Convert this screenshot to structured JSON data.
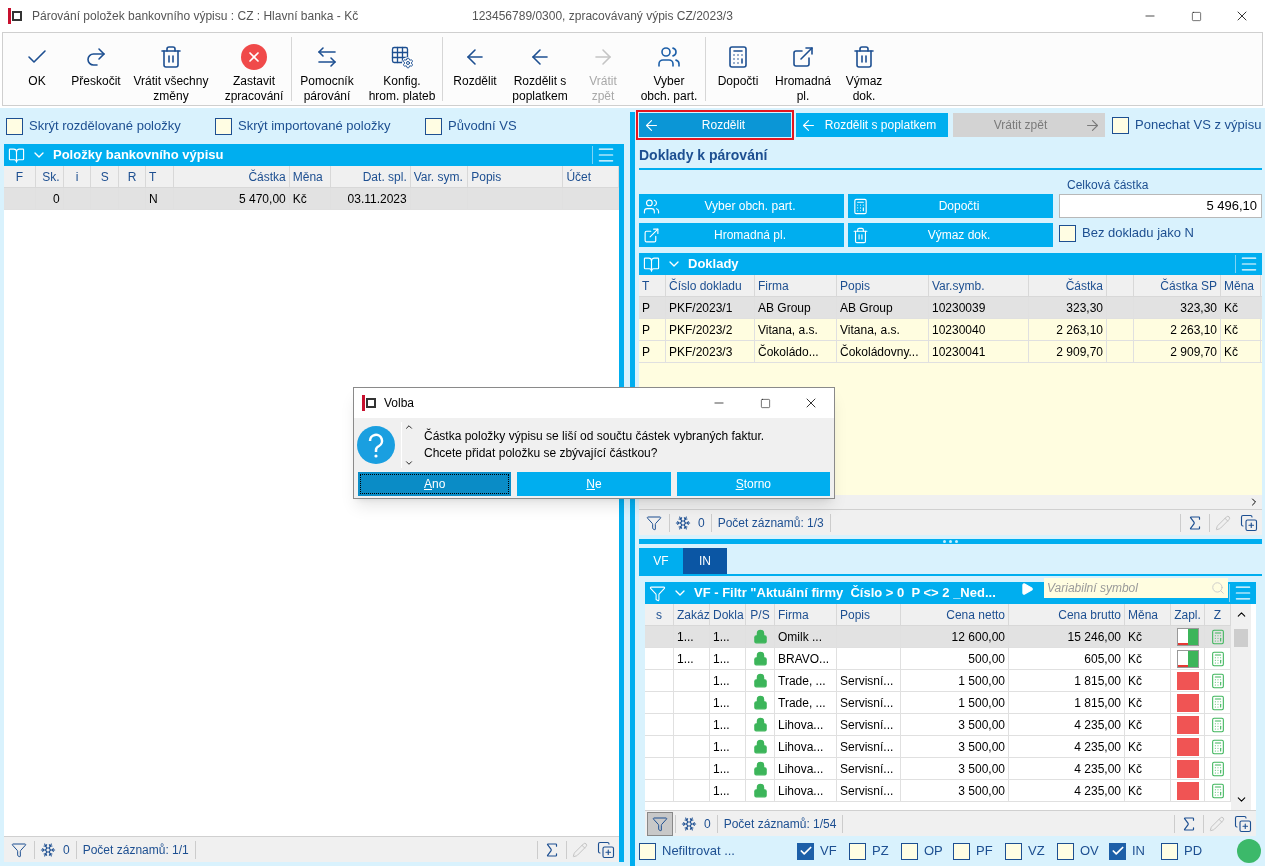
{
  "window": {
    "title": "Párování položek bankovního výpisu : CZ : Hlavní banka - Kč",
    "subtitle": "123456789/0300, zpracovávaný výpis CZ/2023/3"
  },
  "toolbar": [
    [
      {
        "label": "OK",
        "disabled": false
      },
      {
        "label": "Přeskočit",
        "disabled": false
      },
      {
        "label": "Vrátit všechny\nzměny",
        "disabled": false
      },
      {
        "label": "Zastavit\nzpracování",
        "disabled": false
      }
    ],
    [
      {
        "label": "Pomocník\npárování",
        "disabled": false
      },
      {
        "label": "Konfig.\nhrom. plateb",
        "disabled": false
      }
    ],
    [
      {
        "label": "Rozdělit",
        "disabled": false
      },
      {
        "label": "Rozdělit s\npoplatkem",
        "disabled": false
      },
      {
        "label": "Vrátit\nzpět",
        "disabled": true
      },
      {
        "label": "Vyber\nobch. part.",
        "disabled": false
      }
    ],
    [
      {
        "label": "Dopočti",
        "disabled": false
      },
      {
        "label": "Hromadná\npl.",
        "disabled": false
      },
      {
        "label": "Výmaz\ndok.",
        "disabled": false
      }
    ]
  ],
  "left_panel": {
    "options": [
      {
        "label": "Skrýt rozdělované položky",
        "checked": false
      },
      {
        "label": "Skrýt importované položky",
        "checked": false
      },
      {
        "label": "Původní VS",
        "checked": false
      }
    ],
    "grid": {
      "title": "Položky bankovního výpisu",
      "columns": [
        "F",
        "Sk.",
        "i",
        "S",
        "R",
        "T",
        "Částka",
        "Měna",
        "Dat. spl.",
        "Var. sym.",
        "Popis",
        "Účet"
      ],
      "rows": [
        {
          "selected": true,
          "cells": [
            null,
            "0",
            null,
            null,
            null,
            "N",
            "5 470,00",
            "Kč",
            "03.11.2023",
            null,
            null,
            null
          ]
        }
      ]
    },
    "footer": {
      "count": "0",
      "records": "Počet záznamů: 1/1"
    }
  },
  "right_panel": {
    "actions": [
      {
        "label": "Rozdělit",
        "highlighted": true,
        "disabled": false
      },
      {
        "label": "Rozdělit s poplatkem",
        "highlighted": false,
        "disabled": false
      },
      {
        "label": "Vrátit zpět",
        "highlighted": false,
        "disabled": true
      }
    ],
    "keep_vs": {
      "label": "Ponechat VS z výpisu",
      "checked": false
    },
    "section_title": "Doklady k párování",
    "doc_buttons": [
      "Vyber obch. part.",
      "Dopočti",
      "Hromadná pl.",
      "Výmaz dok."
    ],
    "total": {
      "label": "Celková částka",
      "value": "5 496,10"
    },
    "no_doc": {
      "label": "Bez dokladu jako N",
      "checked": false
    },
    "docs_grid": {
      "title": "Doklady",
      "columns": [
        "T",
        "Číslo dokladu",
        "Firma",
        "Popis",
        "Var.symb.",
        "Částka",
        null,
        "Částka SP",
        "Měna"
      ],
      "rows": [
        {
          "selected": true,
          "cells": [
            "P",
            "PKF/2023/1",
            "AB Group",
            "AB Group",
            "10230039",
            "323,30",
            null,
            "323,30",
            "Kč"
          ]
        },
        {
          "selected": false,
          "cells": [
            "P",
            "PKF/2023/2",
            "Vitana, a.s.",
            "Vitana, a.s.",
            "10230040",
            "2 263,10",
            null,
            "2 263,10",
            "Kč"
          ]
        },
        {
          "selected": false,
          "cells": [
            "P",
            "PKF/2023/3",
            "Čokoládo...",
            "Čokoládovny...",
            "10230041",
            "2 909,70",
            null,
            "2 909,70",
            "Kč"
          ]
        }
      ],
      "footer": {
        "count": "0",
        "records": "Počet záznamů: 1/3"
      }
    },
    "tabs": [
      {
        "label": "VF",
        "selected": false
      },
      {
        "label": "IN",
        "selected": true
      }
    ],
    "invoices": {
      "filter_title": "VF - Filtr \"Aktuální firmy  Číslo > 0  P <> 2 _Ned...",
      "search_placeholder": "Variabilní symbol",
      "columns": [
        "s",
        "Zakáz",
        "Dokla",
        "P/S",
        "Firma",
        "Popis",
        "Cena netto",
        "Cena brutto",
        "Měna",
        "Zapl.",
        "Z"
      ],
      "rows": [
        {
          "selected": true,
          "kind": "partial",
          "cells": [
            null,
            "1...",
            "1...",
            null,
            "Omilk ...",
            null,
            "12 600,00",
            "15 246,00",
            "Kč",
            null,
            null
          ]
        },
        {
          "selected": false,
          "kind": "partial",
          "cells": [
            null,
            "1...",
            "1...",
            null,
            "BRAVO...",
            null,
            "500,00",
            "605,00",
            "Kč",
            null,
            null
          ]
        },
        {
          "selected": false,
          "kind": "unpaid",
          "cells": [
            null,
            null,
            "1...",
            null,
            "Trade, ...",
            "Servisní...",
            "1 500,00",
            "1 815,00",
            "Kč",
            null,
            null
          ]
        },
        {
          "selected": false,
          "kind": "unpaid",
          "cells": [
            null,
            null,
            "1...",
            null,
            "Trade, ...",
            "Servisní...",
            "1 500,00",
            "1 815,00",
            "Kč",
            null,
            null
          ]
        },
        {
          "selected": false,
          "kind": "unpaid",
          "cells": [
            null,
            null,
            "1...",
            null,
            "Lihova...",
            "Servisní...",
            "3 500,00",
            "4 235,00",
            "Kč",
            null,
            null
          ]
        },
        {
          "selected": false,
          "kind": "unpaid",
          "cells": [
            null,
            null,
            "1...",
            null,
            "Lihova...",
            "Servisní...",
            "3 500,00",
            "4 235,00",
            "Kč",
            null,
            null
          ]
        },
        {
          "selected": false,
          "kind": "unpaid",
          "cells": [
            null,
            null,
            "1...",
            null,
            "Lihova...",
            "Servisní...",
            "3 500,00",
            "4 235,00",
            "Kč",
            null,
            null
          ]
        },
        {
          "selected": false,
          "kind": "unpaid",
          "cells": [
            null,
            null,
            "1...",
            null,
            "Lihova...",
            "Servisní...",
            "3 500,00",
            "4 235,00",
            "Kč",
            null,
            null
          ]
        }
      ],
      "footer": {
        "count": "0",
        "records": "Počet záznamů: 1/54"
      }
    },
    "type_filters": [
      {
        "label": "Nefiltrovat ...",
        "checked": false
      },
      {
        "label": "VF",
        "checked": true
      },
      {
        "label": "PZ",
        "checked": false
      },
      {
        "label": "OP",
        "checked": false
      },
      {
        "label": "PF",
        "checked": false
      },
      {
        "label": "VZ",
        "checked": false
      },
      {
        "label": "OV",
        "checked": false
      },
      {
        "label": "IN",
        "checked": true
      },
      {
        "label": "PD",
        "checked": false
      }
    ]
  },
  "dialog": {
    "title": "Volba",
    "message": "Částka položky výpisu se liší od součtu částek vybraných faktur.\nChcete přidat položku se zbývající částkou?",
    "buttons": [
      {
        "label": "Ano",
        "focused": true
      },
      {
        "label": "Ne",
        "focused": false
      },
      {
        "label": "Storno",
        "focused": false
      }
    ]
  }
}
